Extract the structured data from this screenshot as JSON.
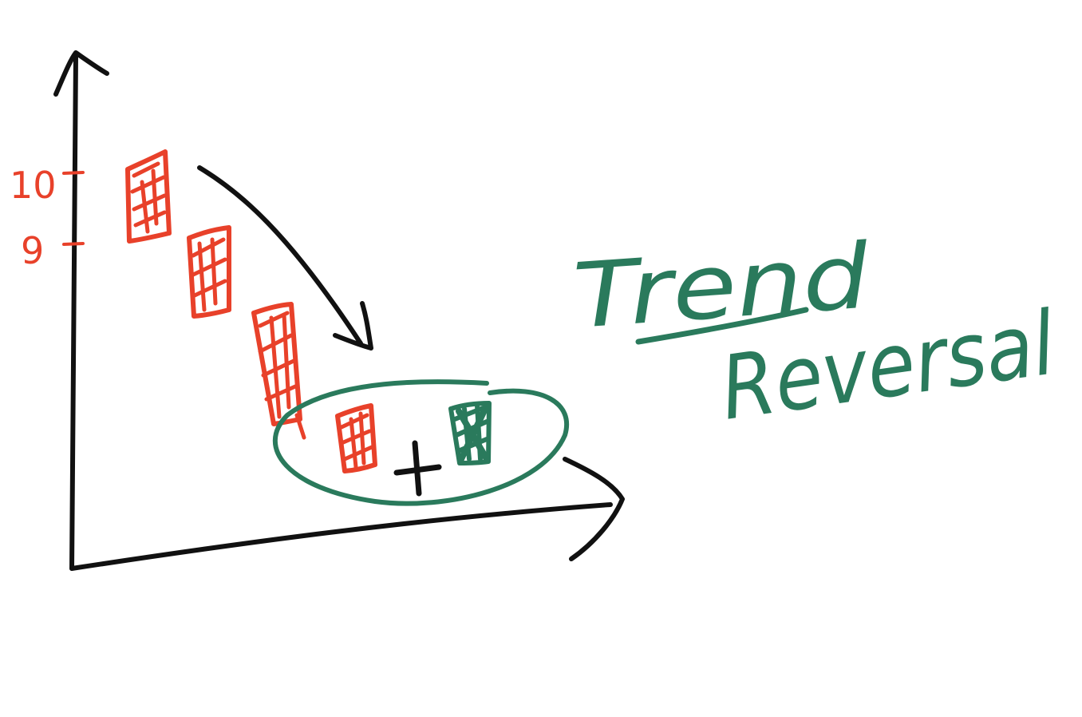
{
  "tick_labels": [
    "10",
    "9"
  ],
  "candles": [
    {
      "color": "red"
    },
    {
      "color": "red"
    },
    {
      "color": "red"
    },
    {
      "color": "red"
    },
    {
      "color": "green"
    }
  ],
  "plus_sign": "+",
  "title_line1": "Trend",
  "title_line2": "Reversal",
  "colors": {
    "ink": "#111111",
    "bearish": "#e8412a",
    "bullish": "#2a7a5c",
    "background": "#ffffff"
  }
}
